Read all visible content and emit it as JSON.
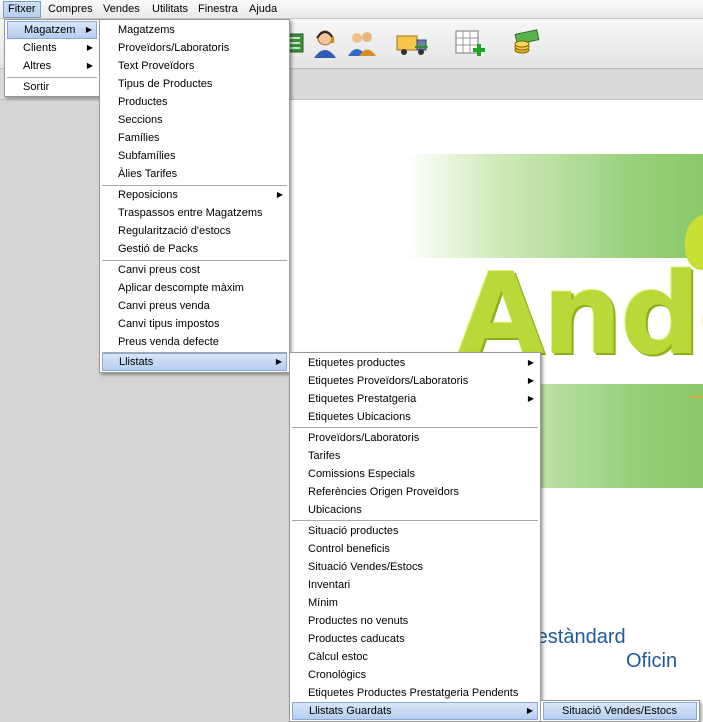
{
  "menubar": {
    "items": [
      "Fitxer",
      "Compres",
      "Vendes",
      "Utilitats",
      "Finestra",
      "Ajuda"
    ]
  },
  "fitxer_menu": {
    "items": [
      {
        "label": "Magatzem",
        "submenu": true
      },
      {
        "label": "Clients",
        "submenu": true
      },
      {
        "label": "Altres",
        "submenu": true
      },
      {
        "label": "Sortir",
        "submenu": false
      }
    ]
  },
  "magatzem_menu": {
    "group1": [
      "Magatzems",
      "Proveïdors/Laboratoris",
      "Text Proveïdors",
      "Tipus de Productes",
      "Productes",
      "Seccions",
      "Famílies",
      "Subfamílies",
      "Àlies Tarifes"
    ],
    "group2": [
      "Reposicions",
      "Traspassos entre Magatzems",
      "Regularització d'estocs",
      "Gestió de Packs"
    ],
    "group3": [
      "Canvi preus cost",
      "Aplicar descompte màxim",
      "Canvi preus venda",
      "Canvi tipus impostos",
      "Preus venda defecte"
    ],
    "llistats": "Llistats"
  },
  "llistats_menu": {
    "group1": [
      "Etiquetes productes",
      "Etiquetes Proveïdors/Laboratoris",
      "Etiquetes Prestatgeria",
      "Etiquetes Ubicacions"
    ],
    "group2": [
      "Proveïdors/Laboratoris",
      "Tarifes",
      "Comissions Especials",
      "Referències Origen Proveïdors",
      "Ubicacions"
    ],
    "group3": [
      "Situació productes",
      "Control beneficis",
      "Situació Vendes/Estocs",
      "Inventari",
      "Mínim",
      "Productes no venuts",
      "Productes caducats",
      "Càlcul estoc",
      "Cronològics",
      "Etiquetes Productes Prestatgeria Pendents"
    ],
    "guardats": "Llistats Guardats"
  },
  "guardats_menu": {
    "items": [
      "Situació Vendes/Estocs"
    ]
  },
  "splash": {
    "logo": "Ando",
    "line1": "n estàndard",
    "line2": "Oficin"
  },
  "toolbar": {
    "icons": [
      "list-icon",
      "support-agent-icon",
      "users-icon",
      "truck-icon",
      "add-grid-icon",
      "money-icon"
    ]
  },
  "colors": {
    "menu_highlight": "#b7cdef",
    "logo_green": "#b8d938",
    "splash_blue": "#1e5a9a"
  }
}
